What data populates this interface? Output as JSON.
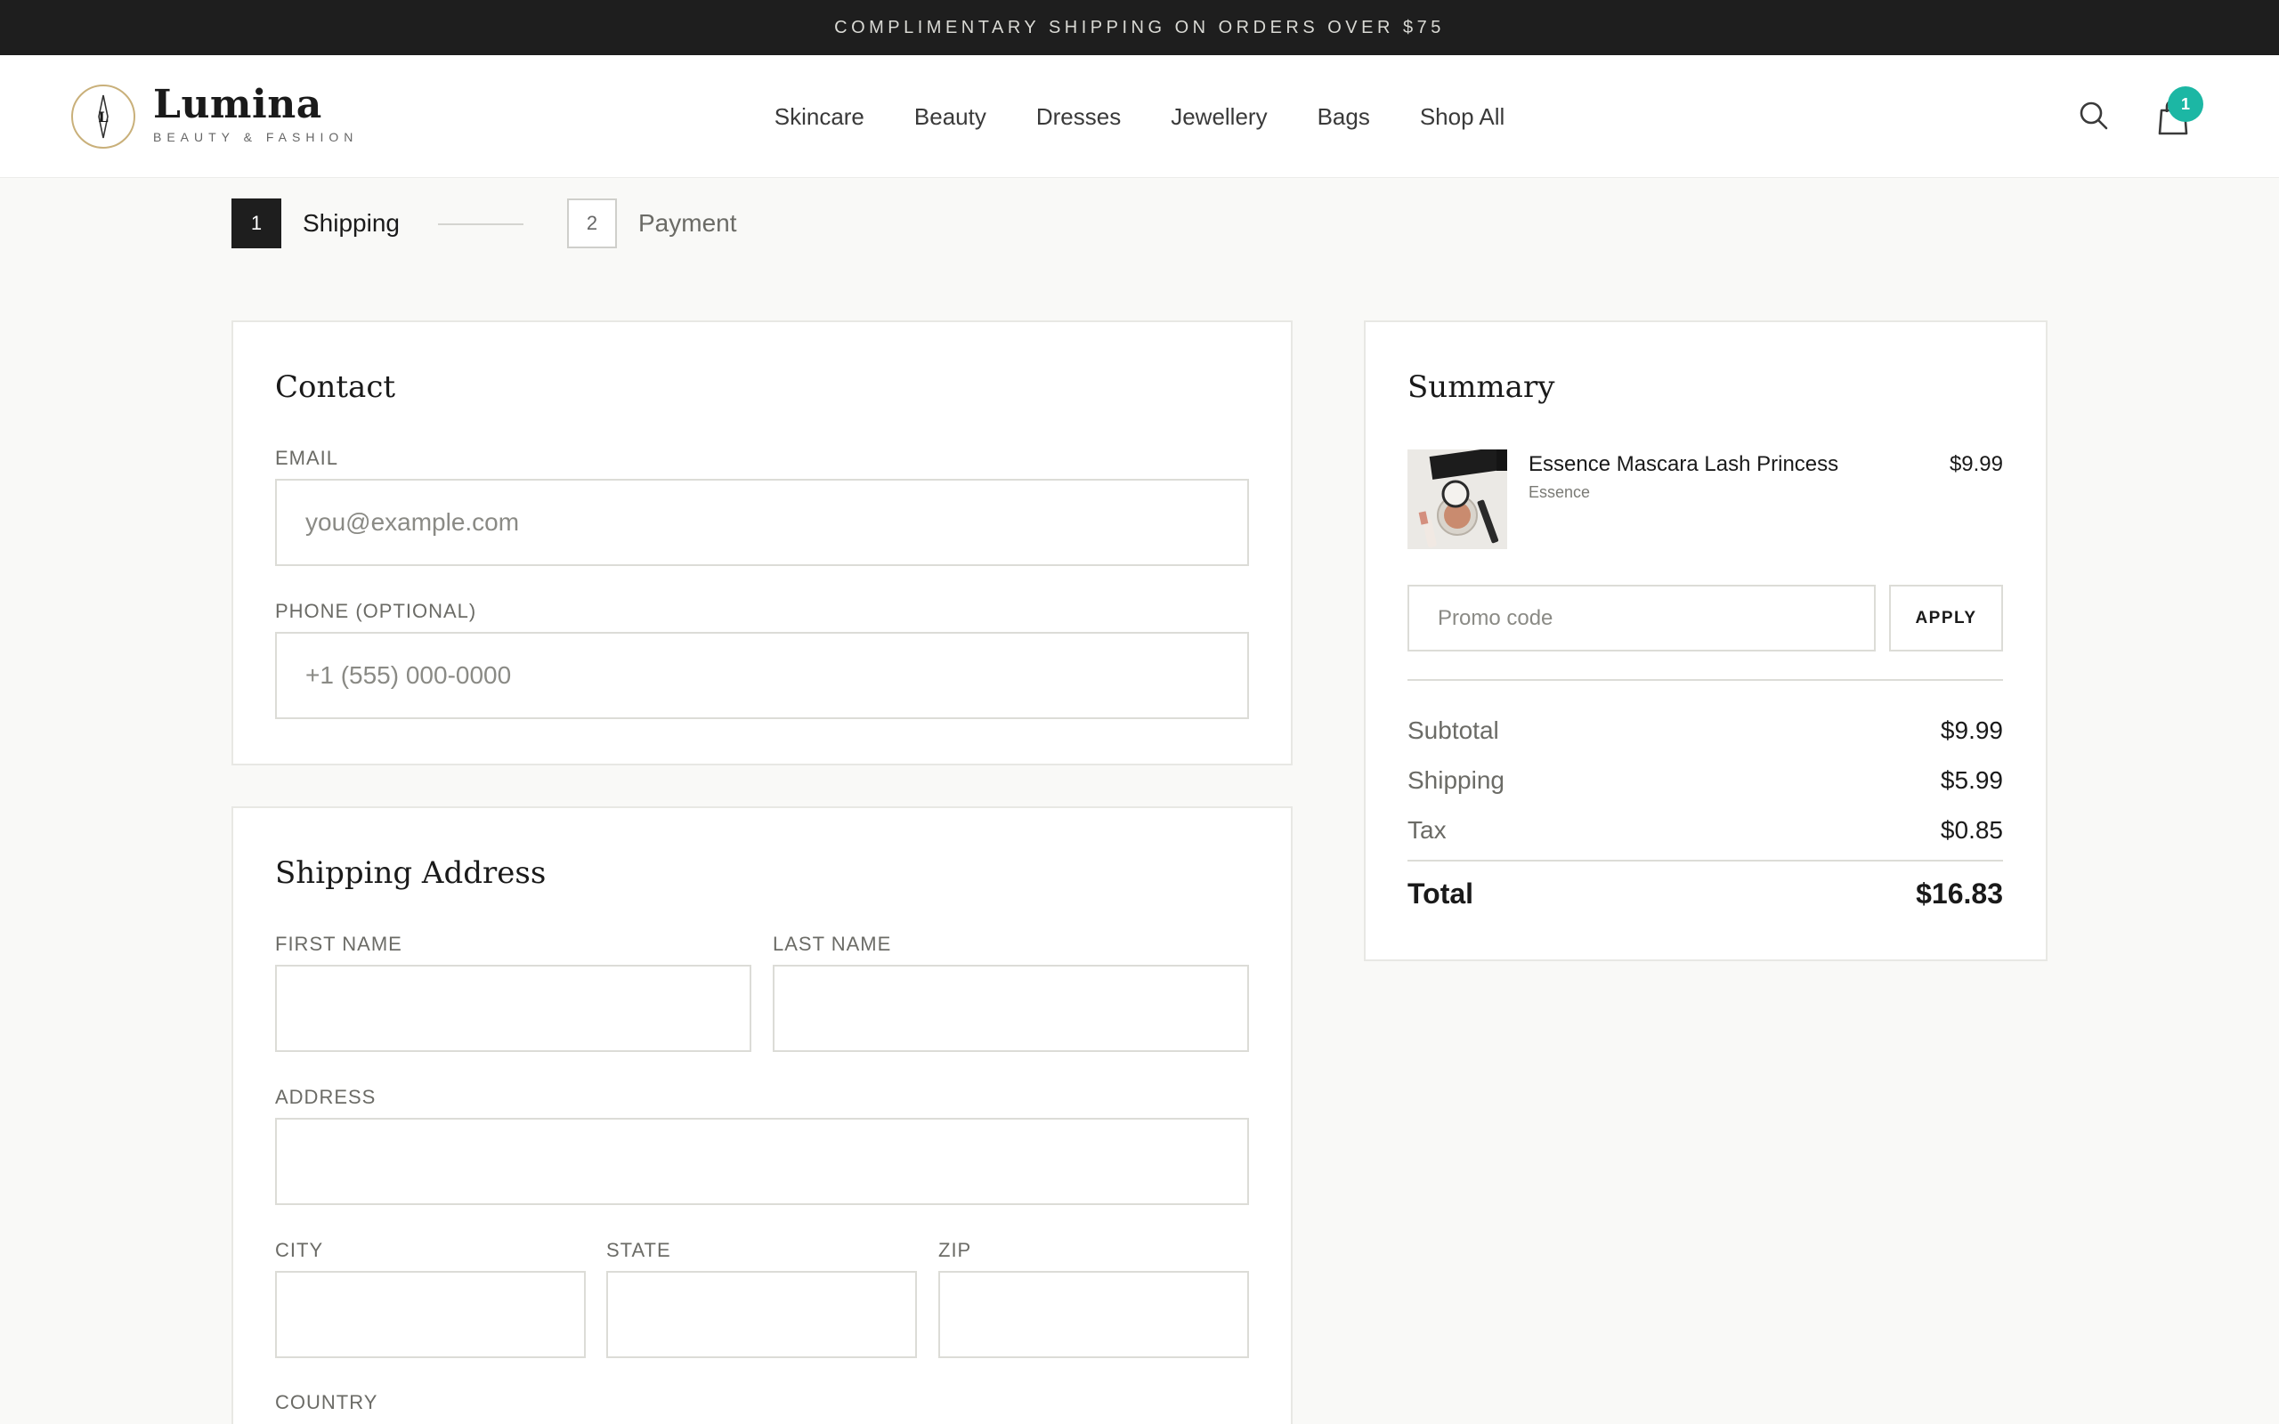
{
  "announcement": "COMPLIMENTARY SHIPPING ON ORDERS OVER $75",
  "brand": {
    "name": "Lumina",
    "tagline": "BEAUTY & FASHION",
    "monogram": "L",
    "accent_color": "#c9b07a"
  },
  "nav": {
    "items": [
      {
        "label": "Skincare"
      },
      {
        "label": "Beauty"
      },
      {
        "label": "Dresses"
      },
      {
        "label": "Jewellery"
      },
      {
        "label": "Bags"
      },
      {
        "label": "Shop All"
      }
    ]
  },
  "header_icons": {
    "search": "search-icon",
    "cart": "shopping-bag-icon",
    "cart_count": "1",
    "badge_color": "#1cb7a4"
  },
  "stepper": {
    "steps": [
      {
        "number": "1",
        "label": "Shipping",
        "active": true
      },
      {
        "number": "2",
        "label": "Payment",
        "active": false
      }
    ]
  },
  "contact": {
    "title": "Contact",
    "email_label": "EMAIL",
    "email_placeholder": "you@example.com",
    "email_value": "",
    "phone_label": "PHONE (OPTIONAL)",
    "phone_placeholder": "+1 (555) 000-0000",
    "phone_value": ""
  },
  "shipping_address": {
    "title": "Shipping Address",
    "first_name_label": "FIRST NAME",
    "last_name_label": "LAST NAME",
    "address_label": "ADDRESS",
    "city_label": "CITY",
    "state_label": "STATE",
    "zip_label": "ZIP",
    "country_label": "COUNTRY"
  },
  "summary": {
    "title": "Summary",
    "item": {
      "name": "Essence Mascara Lash Princess",
      "brand": "Essence",
      "price": "$9.99"
    },
    "promo_placeholder": "Promo code",
    "apply_label": "APPLY",
    "subtotal_label": "Subtotal",
    "subtotal_value": "$9.99",
    "shipping_label": "Shipping",
    "shipping_value": "$5.99",
    "tax_label": "Tax",
    "tax_value": "$0.85",
    "total_label": "Total",
    "total_value": "$16.83"
  }
}
